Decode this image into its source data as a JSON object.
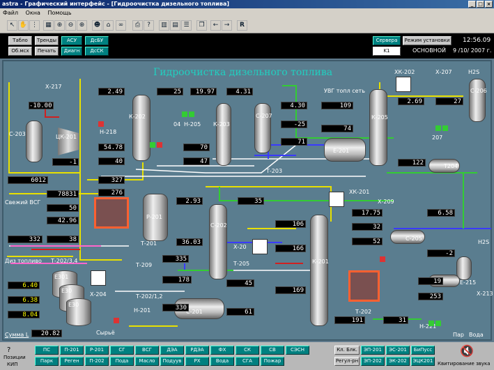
{
  "window": {
    "title": "astra - Графический интерфейс - [Гидроочистка дизельного топлива]"
  },
  "menu": [
    "Файл",
    "Окна",
    "Помощь"
  ],
  "nav": {
    "r1": [
      "Табло",
      "Тренды",
      "АСУ",
      "ДсБУ"
    ],
    "r2": [
      "Об.мсх",
      "Печать",
      "Диагн",
      "ДсСК"
    ]
  },
  "mode": {
    "servers": "Сервера",
    "mode_label": "Режим установки",
    "k1": "K1",
    "main": "ОСНОВНОЙ",
    "time": "12:56.09",
    "date": "9 /10/ 2007 г."
  },
  "scheme": {
    "title": "Гидроочистка дизельного топлива",
    "equip": [
      "Х-217",
      "С-203",
      "ЦК-201",
      "К-202",
      "Н-218",
      "Н-205",
      "К-203",
      "С-207",
      "Т-203",
      "Е-201",
      "К-205",
      "ХК-202",
      "Х-207",
      "С-206",
      "Т204",
      "ХК-201",
      "Х-209",
      "Р-201",
      "Т-201",
      "Т-209",
      "Т-202/3,4",
      "Х-204",
      "Е301",
      "Е30",
      "Е30",
      "Т-202/1,2",
      "Н-201",
      "С-202",
      "Х-20",
      "Т-205",
      "С-201",
      "К-201",
      "Т-202",
      "Н-221",
      "С-205",
      "Е-215",
      "Х-213",
      "Н2S",
      "Н2S",
      "04",
      "207"
    ],
    "labels": {
      "svg": "Свежий ВСГ",
      "diz": "Диз топливо",
      "syr": "Сырьё",
      "sum": "Сумма L",
      "uvg": "УВГ топл сеть",
      "par": "Пар",
      "voda": "Вода"
    },
    "values": [
      "-10.00",
      "2.49",
      "25",
      "19.97",
      "4.31",
      "-1",
      "54.78",
      "40",
      "6012",
      "70",
      "47",
      "4.30",
      "109",
      "-25",
      "74",
      "2.69",
      "27",
      "71",
      "122",
      "327",
      "276",
      "78831",
      "50",
      "42.96",
      "2.93",
      "332",
      "38",
      "36.03",
      "335",
      "178",
      "330",
      "35",
      "106",
      "17.75",
      "6.58",
      "32",
      "52",
      "-2",
      "166",
      "45",
      "169",
      "61",
      "191",
      "31",
      "19",
      "253",
      "6.40",
      "6.38",
      "8.04",
      "20.82"
    ]
  },
  "bottom": {
    "left": [
      "Позиции",
      "КИП"
    ],
    "r1": [
      "ПС",
      "П-201",
      "Р-201",
      "СГ",
      "ВСГ",
      "ДЭА",
      "РДЭА",
      "ФХ",
      "СК",
      "СВ",
      "СЭСН",
      "Кл. Блк.",
      "ЭП-201",
      "ЭС-201",
      "БиПусс"
    ],
    "r2": [
      "Парк",
      "Реген",
      "П-202",
      "Пода",
      "Масло",
      "Подуув",
      "РХ",
      "Вода",
      "СГА",
      "Пожар",
      "Регул-рн",
      "ЭП-202",
      "ЭК-202",
      "ЭЦК201"
    ],
    "ack": "Квитирование звука"
  }
}
